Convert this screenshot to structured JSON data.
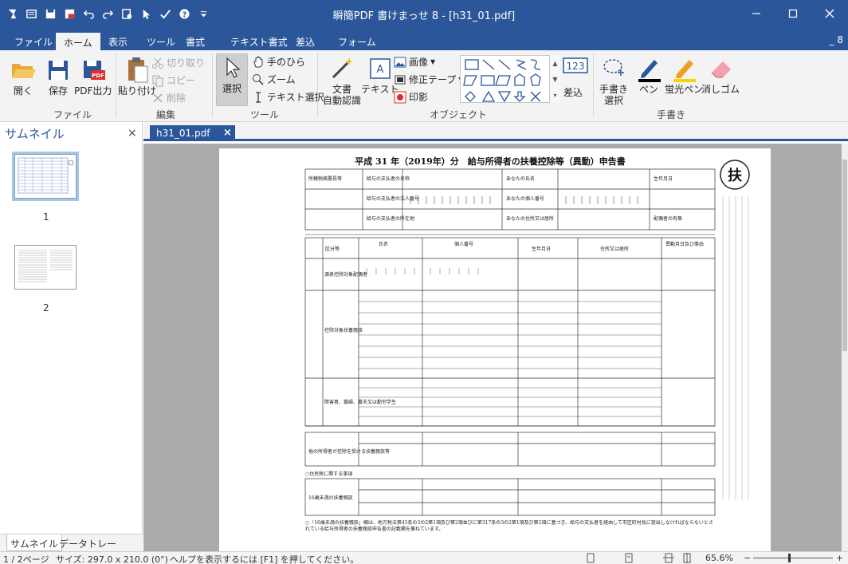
{
  "window": {
    "title": "瞬簡PDF 書けまっせ 8 - [h31_01.pdf]"
  },
  "menu": {
    "tabs": [
      "ファイル",
      "ホーム",
      "表示",
      "ツール",
      "書式",
      "テキスト書式",
      "差込",
      "フォーム"
    ],
    "active": "ホーム",
    "minimize": "_ 8"
  },
  "ribbon": {
    "file_group": {
      "label": "ファイル",
      "open": "開く",
      "save": "保存",
      "pdf_export": "PDF出力"
    },
    "edit_group": {
      "label": "編集",
      "paste": "貼り付け",
      "cut": "切り取り",
      "copy": "コピー",
      "delete": "削除"
    },
    "tool_group": {
      "label": "ツール",
      "select": "選択",
      "hand": "手のひら",
      "zoom": "ズーム",
      "text_select": "テキスト選択"
    },
    "object_group": {
      "label": "オブジェクト",
      "auto_recognize_1": "文書",
      "auto_recognize_2": "自動認識",
      "text": "テキスト",
      "image": "画像",
      "correction_tape": "修正テープ",
      "stamp": "印影",
      "number_box": "123",
      "insert": "差込"
    },
    "handwriting_group": {
      "label": "手書き",
      "select_1": "手書き",
      "select_2": "選択",
      "pen": "ペン",
      "highlighter": "蛍光ペン",
      "eraser": "消しゴム"
    }
  },
  "sidebar": {
    "title": "サムネイル",
    "close": "×",
    "pages": [
      "1",
      "2"
    ],
    "tabs": [
      "サムネイル",
      "データトレー"
    ]
  },
  "document": {
    "tab_name": "h31_01.pdf",
    "tab_close": "×",
    "form": {
      "title": "平成 31 年（2019年）分　給与所得者の扶養控除等（異動）申告書",
      "seal": "扶",
      "row_labels": [
        "源泉控除対象配偶者",
        "控除対象扶養親族",
        "障害者、寡婦、寡夫又は勤労学生",
        "他の所得者が控除を受ける扶養親族等",
        "16歳未満の扶養親族"
      ],
      "col_headers": [
        "区分等",
        "氏名",
        "個人番号",
        "生年月日",
        "住所又は居所",
        "異動月日及び事由"
      ],
      "resident_tax": "○住民税に関する事項",
      "footnote": "○「16歳未満の扶養親族」欄は、地方税法第45条の3の2第1項及び第2項並びに第317条の3の2第1項及び第2項に基づき、給与の支払者を経由して市区町村長に提出しなければならないとされている給与所得者の扶養親族申告書の記載欄を兼ねています。"
    }
  },
  "status": {
    "page": "1 / 2ページ",
    "size": "サイズ: 297.0 x 210.0 (0°)",
    "help": "ヘルプを表示するには [F1] を押してください。",
    "zoom": "65.6%",
    "zoom_level_percent": 44
  },
  "colors": {
    "accent": "#2b579a",
    "ribbon_bg": "#f3f3f3",
    "doc_bg": "#ababab"
  }
}
